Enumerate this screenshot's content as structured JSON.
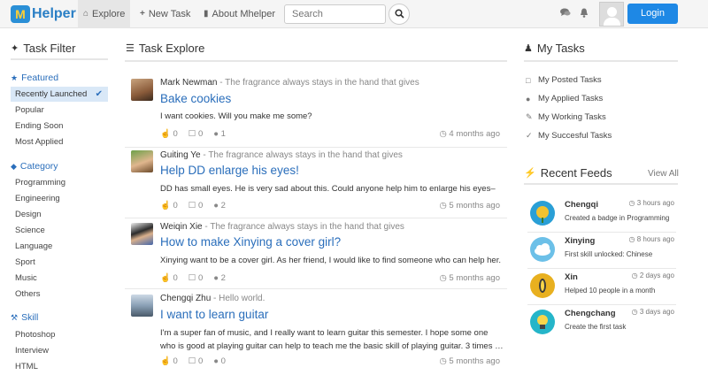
{
  "brand": {
    "badge": "M",
    "name": "Helper"
  },
  "nav": {
    "explore": "Explore",
    "new_task": "New Task",
    "about": "About Mhelper",
    "search_placeholder": "Search",
    "login": "Login"
  },
  "icons": {
    "explore": "home-icon",
    "new_task": "plus-icon",
    "about": "document-icon",
    "search": "search-icon",
    "chat": "chat-icon",
    "bell": "bell-icon",
    "like": "thumbs-up-icon",
    "comment": "comment-icon",
    "applicants": "users-icon",
    "time": "clock-icon"
  },
  "colors": {
    "accent": "#2a6ebb",
    "login": "#1e88e5",
    "selected_bg": "#d9e8f7",
    "logo_badge": "#2a8fd6",
    "logo_letter": "#ffcf33"
  },
  "filter": {
    "title": "Task Filter",
    "featured": {
      "label": "Featured",
      "items": [
        "Recently Launched",
        "Popular",
        "Ending Soon",
        "Most Applied"
      ]
    },
    "category": {
      "label": "Category",
      "items": [
        "Programming",
        "Engineering",
        "Design",
        "Science",
        "Language",
        "Sport",
        "Music",
        "Others"
      ]
    },
    "skill": {
      "label": "Skill",
      "items": [
        "Photoshop",
        "Interview",
        "HTML"
      ]
    }
  },
  "explore": {
    "title": "Task Explore",
    "tasks": [
      {
        "author": "Mark Newman",
        "motto": " - The fragrance always stays in the hand that gives",
        "title": "Bake cookies",
        "desc": "I want cookies. Will you make me some?",
        "likes": "0",
        "comments": "0",
        "applicants": "1",
        "time": "4 months ago"
      },
      {
        "author": "Guiting Ye",
        "motto": " - The fragrance always stays in the hand that gives",
        "title": "Help DD enlarge his eyes!",
        "desc": "DD has small eyes. He is very sad about this. Could anyone help him to enlarge his eyes–",
        "likes": "0",
        "comments": "0",
        "applicants": "2",
        "time": "5 months ago"
      },
      {
        "author": "Weiqin Xie",
        "motto": " - The fragrance always stays in the hand that gives",
        "title": "How to make Xinying a cover girl?",
        "desc": "Xinying want to be a cover girl. As her friend, I would like to find someone who can help her.",
        "likes": "0",
        "comments": "0",
        "applicants": "2",
        "time": "5 months ago"
      },
      {
        "author": "Chengqi Zhu",
        "motto": " - Hello world.",
        "title": "I want to learn guitar",
        "desc": "I'm a super fan of music, and I really want to learn guitar this semester. I hope some one who is good at playing guitar can help to teach me the basic skill of playing guitar. 3 times …",
        "likes": "0",
        "comments": "0",
        "applicants": "0",
        "time": "5 months ago"
      }
    ]
  },
  "my_tasks": {
    "title": "My Tasks",
    "items": [
      "My Posted Tasks",
      "My Applied Tasks",
      "My Working Tasks",
      "My Succesful Tasks"
    ]
  },
  "feeds": {
    "title": "Recent Feeds",
    "view_all": "View All",
    "items": [
      {
        "name": "Chengqi",
        "time": "3 hours ago",
        "text": "Created a badge in Programming"
      },
      {
        "name": "Xinying",
        "time": "8 hours ago",
        "text": "First skill unlocked: Chinese"
      },
      {
        "name": "Xin",
        "time": "2 days ago",
        "text": "Helped 10 people in a month"
      },
      {
        "name": "Chengchang",
        "time": "3 days ago",
        "text": "Create the first task"
      }
    ]
  }
}
